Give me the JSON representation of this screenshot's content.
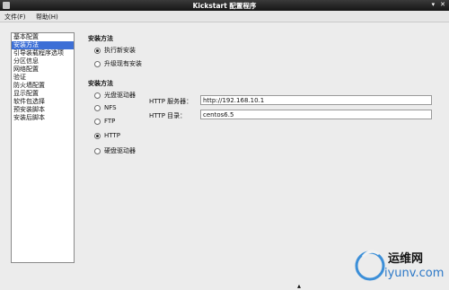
{
  "window": {
    "title": "Kickstart 配置程序",
    "buttons": [
      "▾",
      "✕"
    ]
  },
  "menu": {
    "file": "文件(F)",
    "help": "帮助(H)"
  },
  "sidebar": {
    "items": [
      {
        "label": "基本配置",
        "selected": false
      },
      {
        "label": "安装方法",
        "selected": true
      },
      {
        "label": "引导装载程序选项",
        "selected": false
      },
      {
        "label": "分区信息",
        "selected": false
      },
      {
        "label": "网络配置",
        "selected": false
      },
      {
        "label": "验证",
        "selected": false
      },
      {
        "label": "防火墙配置",
        "selected": false
      },
      {
        "label": "显示配置",
        "selected": false
      },
      {
        "label": "软件包选择",
        "selected": false
      },
      {
        "label": "预安装脚本",
        "selected": false
      },
      {
        "label": "安装后脚本",
        "selected": false
      }
    ]
  },
  "install_type": {
    "title": "安装方法",
    "options": [
      {
        "label": "执行新安装",
        "checked": true
      },
      {
        "label": "升级现有安装",
        "checked": false
      }
    ]
  },
  "install_method": {
    "title": "安装方法",
    "options": [
      {
        "label": "光盘驱动器",
        "checked": false
      },
      {
        "label": "NFS",
        "checked": false
      },
      {
        "label": "FTP",
        "checked": false
      },
      {
        "label": "HTTP",
        "checked": true
      },
      {
        "label": "硬盘驱动器",
        "checked": false
      }
    ]
  },
  "http": {
    "server_label": "HTTP 服务器：",
    "server_value": "http://192.168.10.1",
    "dir_label": "HTTP 目录：",
    "dir_value": "centos6.5"
  },
  "watermark": {
    "text": "运维网",
    "url": "iyunv.com"
  }
}
